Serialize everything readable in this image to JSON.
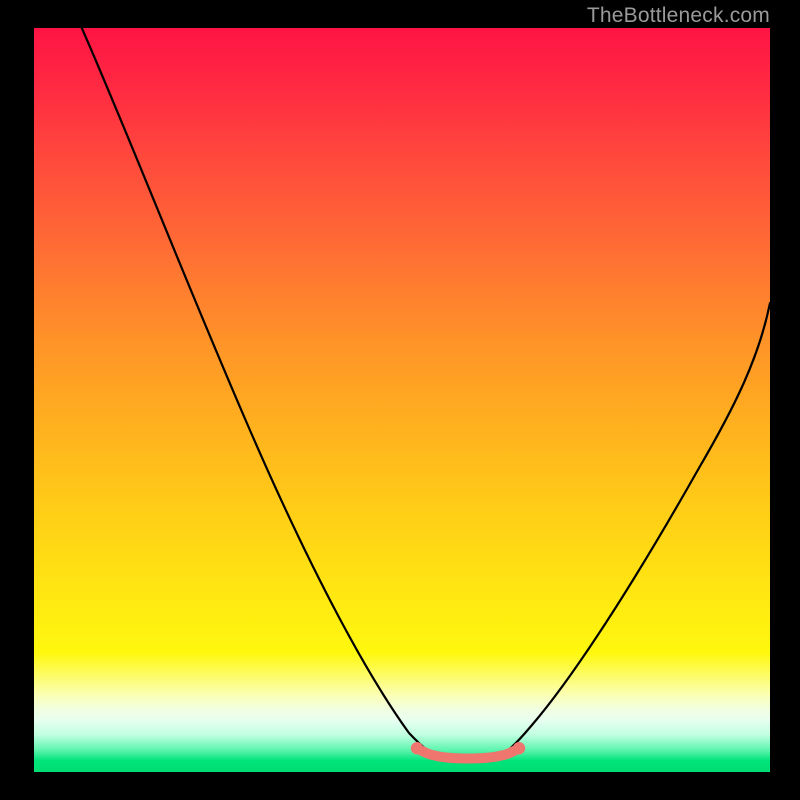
{
  "watermark": "TheBottleneck.com",
  "chart_data": {
    "type": "line",
    "title": "",
    "xlabel": "",
    "ylabel": "",
    "xlim": [
      0,
      100
    ],
    "ylim": [
      0,
      100
    ],
    "grid": false,
    "series": [
      {
        "name": "left-curve",
        "x": [
          6.5,
          12,
          18,
          24,
          30,
          36,
          42,
          47,
          52,
          54.5
        ],
        "y": [
          100,
          87,
          73,
          59,
          45,
          31.5,
          19,
          9.5,
          3.2,
          2.2
        ]
      },
      {
        "name": "flat-bottom",
        "x": [
          54.5,
          56,
          58,
          60,
          62,
          63.5
        ],
        "y": [
          2.2,
          1.9,
          1.8,
          1.8,
          1.9,
          2.2
        ]
      },
      {
        "name": "right-curve",
        "x": [
          63.5,
          66,
          70,
          75,
          81,
          88,
          95,
          100
        ],
        "y": [
          2.2,
          3.6,
          8.5,
          17,
          28,
          41,
          54,
          63
        ]
      },
      {
        "name": "salmon-overlay",
        "stroke": "#ee766f",
        "stroke_width_px": 10,
        "x": [
          52,
          54.5,
          56,
          58,
          60,
          62,
          63.5
        ],
        "y": [
          3.2,
          2.2,
          1.9,
          1.8,
          1.8,
          1.9,
          2.2
        ]
      }
    ],
    "background_gradient": {
      "direction": "vertical",
      "stops": [
        {
          "pos": 0.0,
          "color": "#ff1444"
        },
        {
          "pos": 0.3,
          "color": "#ff6e34"
        },
        {
          "pos": 0.66,
          "color": "#ffd016"
        },
        {
          "pos": 0.84,
          "color": "#fff80e"
        },
        {
          "pos": 0.93,
          "color": "#e8fff0"
        },
        {
          "pos": 1.0,
          "color": "#00dd72"
        }
      ]
    }
  }
}
